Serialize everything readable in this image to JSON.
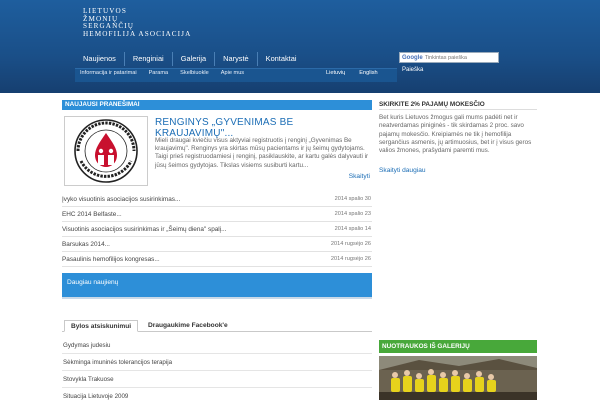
{
  "header": {
    "logo_lines": [
      "LIETUVOS",
      "ŽMONIŲ",
      "SERGANČIŲ",
      "HEMOFILIJA ASOCIACIJA"
    ],
    "main_nav": [
      "Naujienos",
      "Renginiai",
      "Galerija",
      "Narystė",
      "Kontaktai"
    ],
    "sub_nav": [
      "Informacija ir patarimai",
      "Parama",
      "Skelbiuokle",
      "Apie mus"
    ],
    "languages": [
      "Lietuvių",
      "English"
    ],
    "search_brand": "Google",
    "search_placeholder": "Tinkintas paieška",
    "search_button": "Paieška"
  },
  "news": {
    "section_title": "NAUJAUSI PRANEŠIMAI",
    "featured_title": "RENGINYS „GYVENIMAS BE KRAUJAVIMŲ\"...",
    "featured_text": "Mieli draugai kviečiu visus aktyviai registruotis į renginį „Gyvenimas Be kraujavimų\". Renginys yra skirtas mūsų pacientams ir jų šeimų gydytojams. Taigi prieš registruodamiesi į renginį, pasiklauskite, ar kartu galės dalyvauti ir jūsų šeimos gydytojas. Tikslas visiems susiburti kartu...",
    "read_more": "Skaityti",
    "items": [
      {
        "title": "Įvyko visuotinis asociacijos susirinkimas...",
        "date": "2014 spalio 30"
      },
      {
        "title": "EHC 2014 Belfaste...",
        "date": "2014 spalio 23"
      },
      {
        "title": "Visuotinis asociacijos susirinkimas ir „Šeimų diena\" spalį...",
        "date": "2014 spalio 14"
      },
      {
        "title": "Barsukas 2014...",
        "date": "2014 rugsėjo 26"
      },
      {
        "title": "Pasaulinis hemofilijos kongresas...",
        "date": "2014 rugsėjo 26"
      }
    ],
    "more_news": "Daugiau naujienų"
  },
  "tabs": {
    "active": "Bylos atsiskunimui",
    "inactive": "Draugaukime Facebook'e"
  },
  "cases": [
    "Gydymas judesiu",
    "Sėkminga imuninės tolerancijos terapija",
    "Stovykla Trakuose",
    "Situacija Lietuvoje 2009"
  ],
  "tax": {
    "title": "SKIRKITE 2% PAJAMŲ MOKESČIO",
    "text": "Bet kuris Lietuvos žmogus gali mums padėti net ir neatverdamas piniginės - tik skirdamas 2 proc. savo pajamų mokesčio. Kreipiamės ne tik į hemofilija sergančius asmenis, jų artimuosius, bet ir į visus geros valios žmones, prašydami paremti mus.",
    "more": "Skaityti daugiau"
  },
  "gallery": {
    "title": "NUOTRAUKOS IŠ GALERIJŲ"
  },
  "colors": {
    "header_blue": "#1a4f88",
    "accent_blue": "#2d8fd8",
    "link_blue": "#1b6db5",
    "gallery_green": "#48a83a"
  }
}
